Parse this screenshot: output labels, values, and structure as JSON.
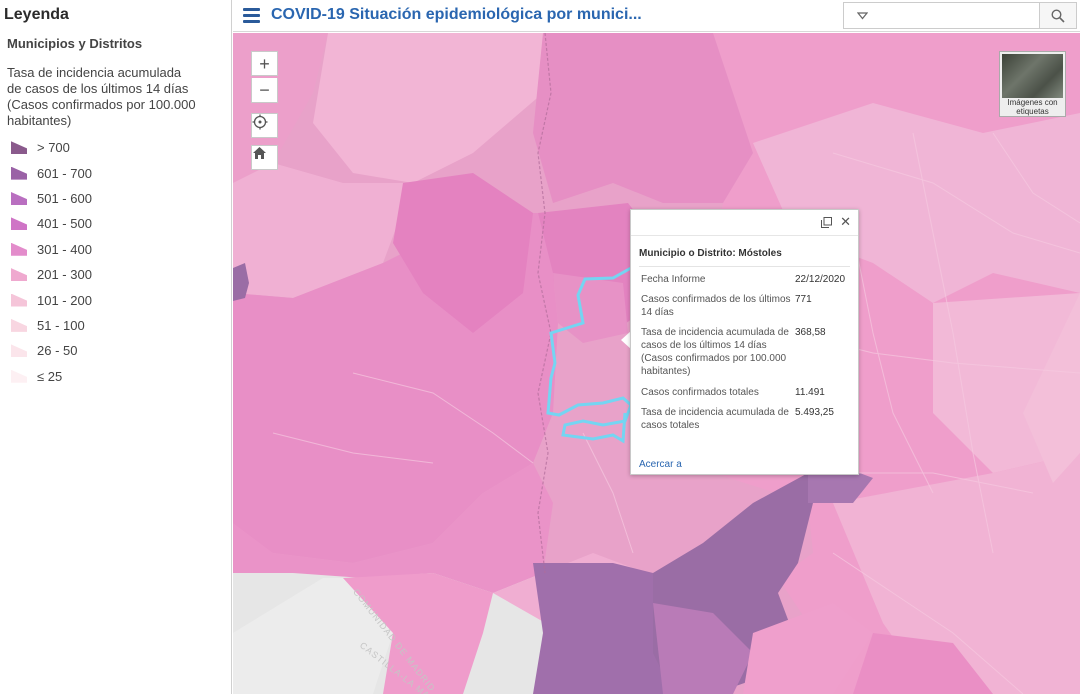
{
  "legend": {
    "title": "Leyenda",
    "layer_name": "Municipios y Distritos",
    "field_label": "Tasa de incidencia acumulada de casos de los últimos 14 días (Casos confirmados por 100.000 habitantes)",
    "classes": [
      {
        "label": "> 700",
        "color": "#8a5a8c"
      },
      {
        "label": "601 - 700",
        "color": "#9a62a6"
      },
      {
        "label": "501 - 600",
        "color": "#b96fc0"
      },
      {
        "label": "401 - 500",
        "color": "#cf74c6"
      },
      {
        "label": "301 - 400",
        "color": "#e38ccb"
      },
      {
        "label": "201 - 300",
        "color": "#efa9cf"
      },
      {
        "label": "101 - 200",
        "color": "#f5c5d9"
      },
      {
        "label": "51 - 100",
        "color": "#f8d6e1"
      },
      {
        "label": "26 - 50",
        "color": "#fbe5eb"
      },
      {
        "label": "≤ 25",
        "color": "#fdf0f3"
      }
    ]
  },
  "header": {
    "title": "COVID-19 Situación epidemiológica por munici...",
    "search_placeholder": ""
  },
  "map": {
    "zoom_in": "+",
    "zoom_out": "−",
    "basemap_label": "Imágenes con etiquetas",
    "boundary_labels": [
      "COMUNIDAD DE MADRID",
      "CASTILLA-LA MA"
    ]
  },
  "popup": {
    "title": "Municipio o Distrito: Móstoles",
    "rows": [
      {
        "key": "Fecha Informe",
        "value": "22/12/2020"
      },
      {
        "key": "Casos confirmados de los últimos 14 días",
        "value": "771"
      },
      {
        "key": "Tasa de incidencia acumulada de casos de los últimos 14 días (Casos confirmados por 100.000 habitantes)",
        "value": "368,58"
      },
      {
        "key": "Casos confirmados totales",
        "value": "11.491"
      },
      {
        "key": "Tasa de incidencia acumulada de casos totales",
        "value": "5.493,25"
      }
    ],
    "zoom_link": "Acercar a"
  }
}
